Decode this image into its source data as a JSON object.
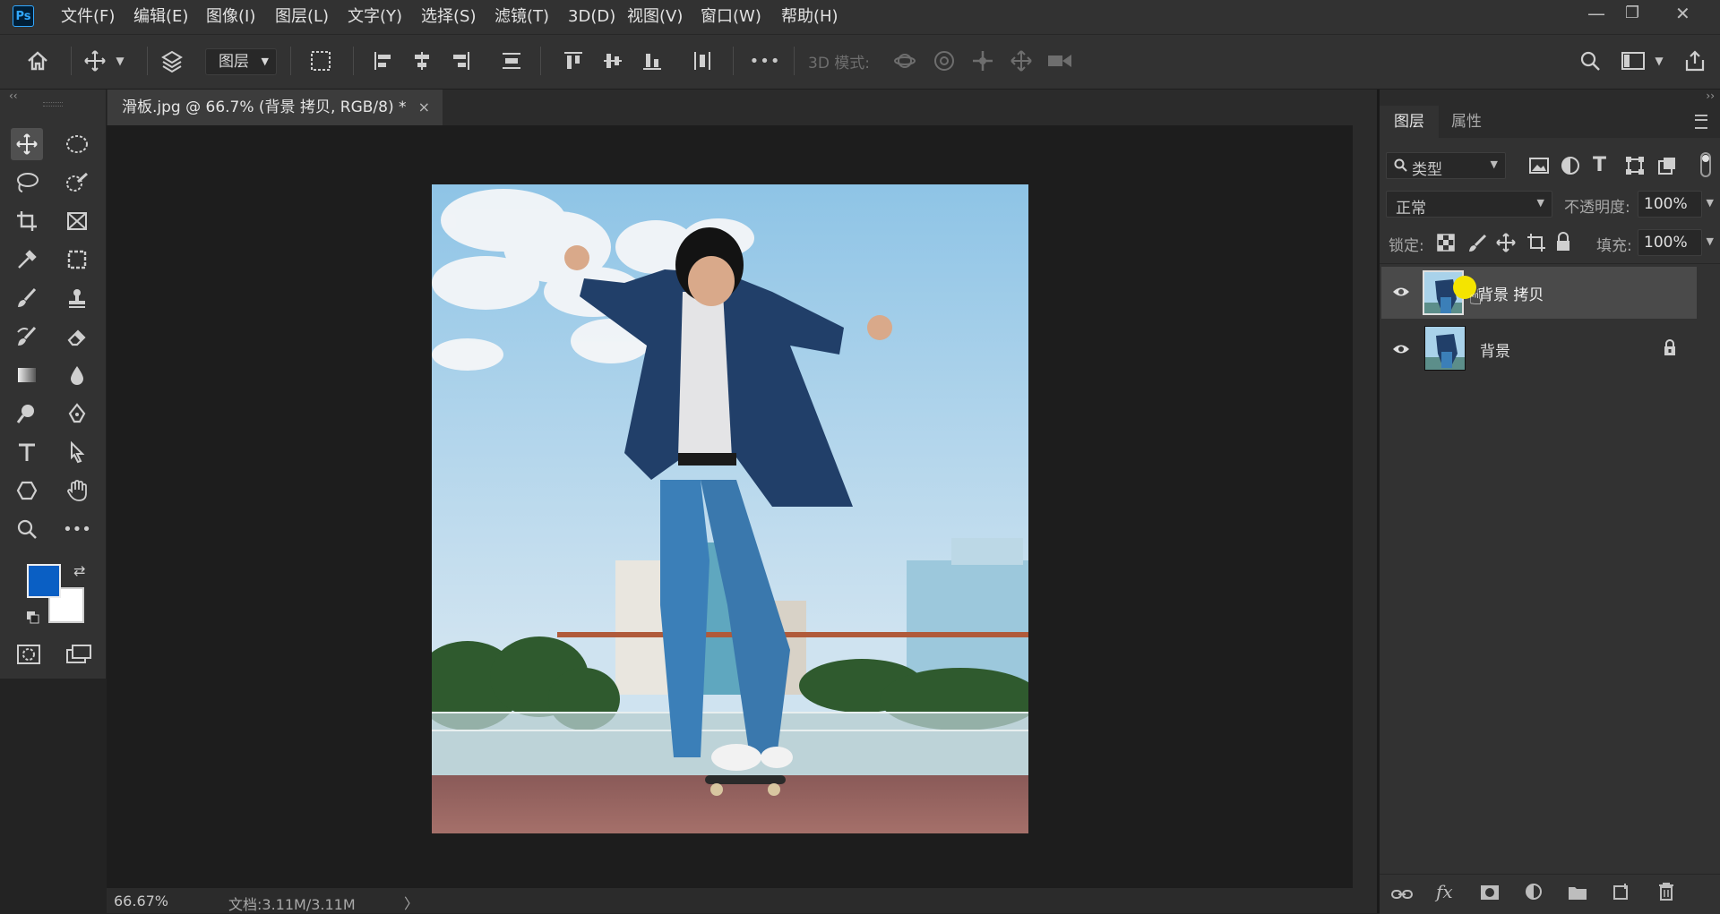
{
  "app": {
    "logo": "Ps"
  },
  "menu": [
    "文件(F)",
    "编辑(E)",
    "图像(I)",
    "图层(L)",
    "文字(Y)",
    "选择(S)",
    "滤镜(T)",
    "3D(D)",
    "视图(V)",
    "窗口(W)",
    "帮助(H)"
  ],
  "window_controls": {
    "minimize": "—",
    "restore": "❐",
    "close": "✕"
  },
  "options_bar": {
    "auto_select_target": "图层",
    "mode_3d_label": "3D 模式:",
    "more": "•••"
  },
  "document": {
    "tab_title": "滑板.jpg @ 66.7% (背景 拷贝, RGB/8) *",
    "tab_close": "×"
  },
  "status_bar": {
    "zoom": "66.67%",
    "doc_size": "文档:3.11M/3.11M",
    "arrow": "〉"
  },
  "colors": {
    "foreground": "#0a5fc4",
    "background": "#ffffff",
    "accent": "#31a8ff"
  },
  "panels": {
    "tabs": [
      "图层",
      "属性"
    ],
    "active_tab": "图层",
    "filter_kind": "类型",
    "blend_mode": "正常",
    "opacity_label": "不透明度:",
    "opacity_value": "100%",
    "lock_label": "锁定:",
    "fill_label": "填充:",
    "fill_value": "100%",
    "layers": [
      {
        "name": "背景 拷贝",
        "visible": true,
        "selected": true,
        "locked": false
      },
      {
        "name": "背景",
        "visible": true,
        "selected": false,
        "locked": true
      }
    ]
  }
}
